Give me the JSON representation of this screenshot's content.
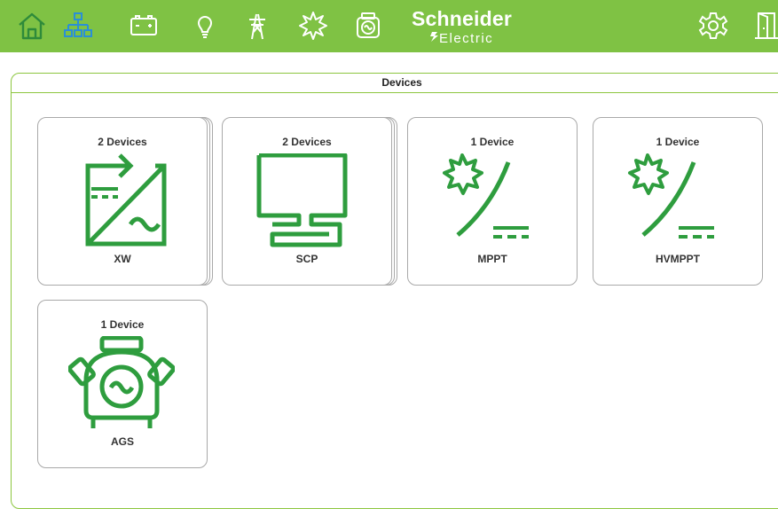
{
  "header": {
    "brand_main": "Schneider",
    "brand_sub": "Electric",
    "bar_color": "#7fc244",
    "nav_icons": [
      "home-icon",
      "network-icon",
      "battery-icon",
      "lightbulb-icon",
      "transmission-tower-icon",
      "sun-icon",
      "generator-icon"
    ],
    "right_icons": [
      "gear-icon",
      "exit-door-icon"
    ]
  },
  "panel": {
    "title": "Devices"
  },
  "devices": [
    {
      "count": "2 Devices",
      "name": "XW",
      "icon": "inverter-icon"
    },
    {
      "count": "2 Devices",
      "name": "SCP",
      "icon": "control-panel-icon"
    },
    {
      "count": "1 Device",
      "name": "MPPT",
      "icon": "solar-charger-icon"
    },
    {
      "count": "1 Device",
      "name": "HVMPPT",
      "icon": "solar-charger-icon"
    },
    {
      "count": "1 Device",
      "name": "AGS",
      "icon": "generator-icon"
    }
  ],
  "colors": {
    "icon_green": "#2e9d3e",
    "accent": "#8cc63f"
  }
}
